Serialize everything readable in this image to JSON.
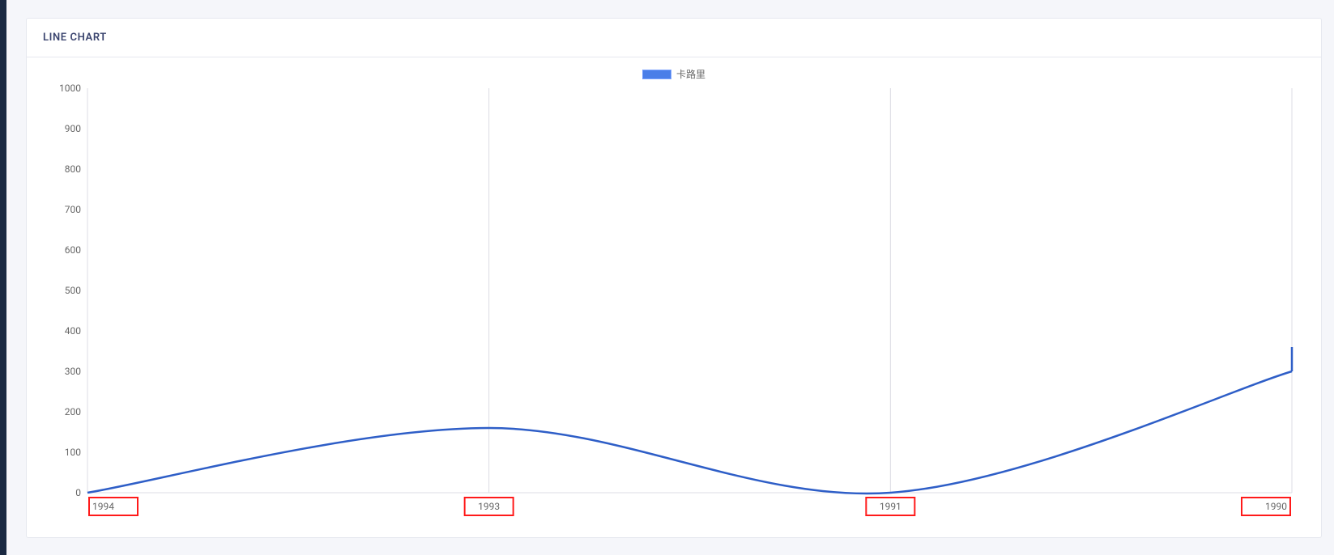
{
  "panel": {
    "title": "LINE CHART"
  },
  "legend": {
    "series_label": "卡路里",
    "swatch_color": "#4a7ee8"
  },
  "chart_data": {
    "type": "line",
    "categories": [
      "1994",
      "1993",
      "1991",
      "1990"
    ],
    "series": [
      {
        "name": "卡路里",
        "values": [
          0,
          160,
          0,
          300
        ]
      }
    ],
    "title": "",
    "xlabel": "",
    "ylabel": "",
    "ylim": [
      0,
      1000
    ],
    "yticks": [
      0,
      100,
      200,
      300,
      400,
      500,
      600,
      700,
      800,
      900,
      1000
    ],
    "highlight_x": [
      "1994",
      "1993",
      "1991",
      "1990"
    ],
    "legend_position": "top",
    "grid": true
  },
  "colors": {
    "line": "#2e5ec7",
    "grid": "#dcdde4",
    "highlight_stroke": "#ff1a1a"
  }
}
